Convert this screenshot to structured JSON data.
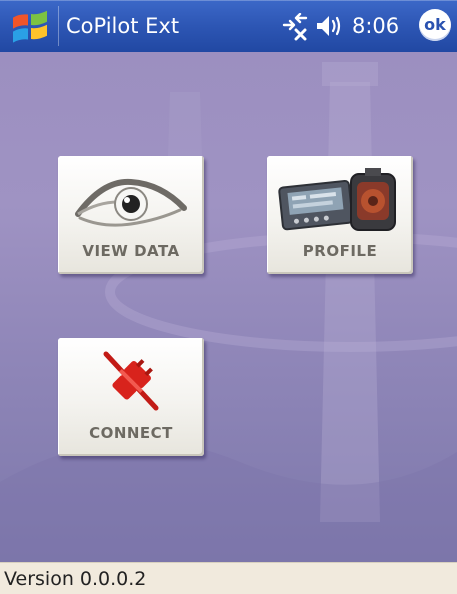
{
  "titlebar": {
    "app_title": "CoPilot Ext",
    "time": "8:06",
    "ok_label": "ok",
    "start_icon": "windows-flag-icon",
    "connectivity_icon": "connectivity-icon",
    "volume_icon": "volume-icon"
  },
  "tiles": [
    {
      "label": "VIEW DATA",
      "icon": "eye-icon"
    },
    {
      "label": "PROFILE",
      "icon": "devices-icon"
    },
    {
      "label": "CONNECT",
      "icon": "plug-icon"
    }
  ],
  "statusbar": {
    "version": "Version 0.0.0.2"
  },
  "colors": {
    "titlebar": "#2d56b4",
    "background": "#9b8fbf",
    "tile_label": "#6d6a62",
    "statusbar": "#f1eadd",
    "connect_red": "#d8231c"
  }
}
